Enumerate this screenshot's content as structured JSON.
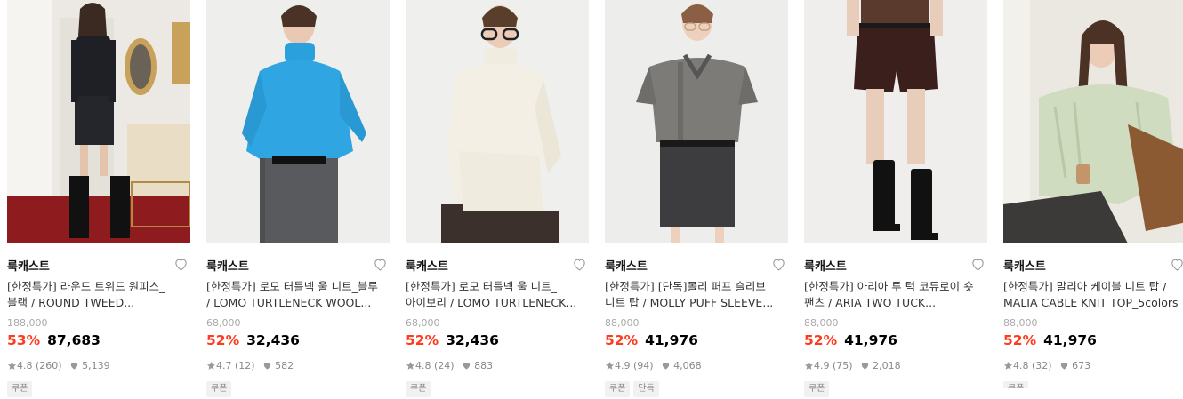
{
  "products": [
    {
      "brand": "룩캐스트",
      "name_line1": "[한정특가] 라운드 트위드 원피스_",
      "name_line2": "블랙 / ROUND TWEED...",
      "original_price": "188,000",
      "discount": "53%",
      "sale_price": "87,683",
      "rating": "4.8",
      "reviews": "(260)",
      "likes": "5,139",
      "tags": [
        "쿠폰"
      ]
    },
    {
      "brand": "룩캐스트",
      "name_line1": "[한정특가] 로모 터틀넥 울 니트_블루",
      "name_line2": "/ LOMO TURTLENECK WOOL...",
      "original_price": "68,000",
      "discount": "52%",
      "sale_price": "32,436",
      "rating": "4.7",
      "reviews": "(12)",
      "likes": "582",
      "tags": [
        "쿠폰"
      ]
    },
    {
      "brand": "룩캐스트",
      "name_line1": "[한정특가] 로모 터틀넥 울 니트_",
      "name_line2": "아이보리 / LOMO TURTLENECK...",
      "original_price": "68,000",
      "discount": "52%",
      "sale_price": "32,436",
      "rating": "4.8",
      "reviews": "(24)",
      "likes": "883",
      "tags": [
        "쿠폰"
      ]
    },
    {
      "brand": "룩캐스트",
      "name_line1": "[한정특가] [단독]몰리 퍼프 슬리브",
      "name_line2": "니트 탑 / MOLLY PUFF SLEEVE...",
      "original_price": "88,000",
      "discount": "52%",
      "sale_price": "41,976",
      "rating": "4.9",
      "reviews": "(94)",
      "likes": "4,068",
      "tags": [
        "쿠폰",
        "단독"
      ]
    },
    {
      "brand": "룩캐스트",
      "name_line1": "[한정특가] 아리아 투 턱 코듀로이 숏",
      "name_line2": "팬츠 / ARIA TWO TUCK...",
      "original_price": "88,000",
      "discount": "52%",
      "sale_price": "41,976",
      "rating": "4.9",
      "reviews": "(75)",
      "likes": "2,018",
      "tags": [
        "쿠폰"
      ]
    },
    {
      "brand": "룩캐스트",
      "name_line1": "[한정특가] 말리아 케이블 니트 탑 /",
      "name_line2": "MALIA CABLE KNIT TOP_5colors",
      "original_price": "88,000",
      "discount": "52%",
      "sale_price": "41,976",
      "rating": "4.8",
      "reviews": "(32)",
      "likes": "673",
      "tags": [
        "쿠폰"
      ]
    }
  ],
  "colors": {
    "discount": "#ff3b1f",
    "meta": "#888888"
  },
  "icons": {
    "wishlist": "heart-outline-icon",
    "rating": "star-icon",
    "likes": "heart-filled-icon"
  }
}
